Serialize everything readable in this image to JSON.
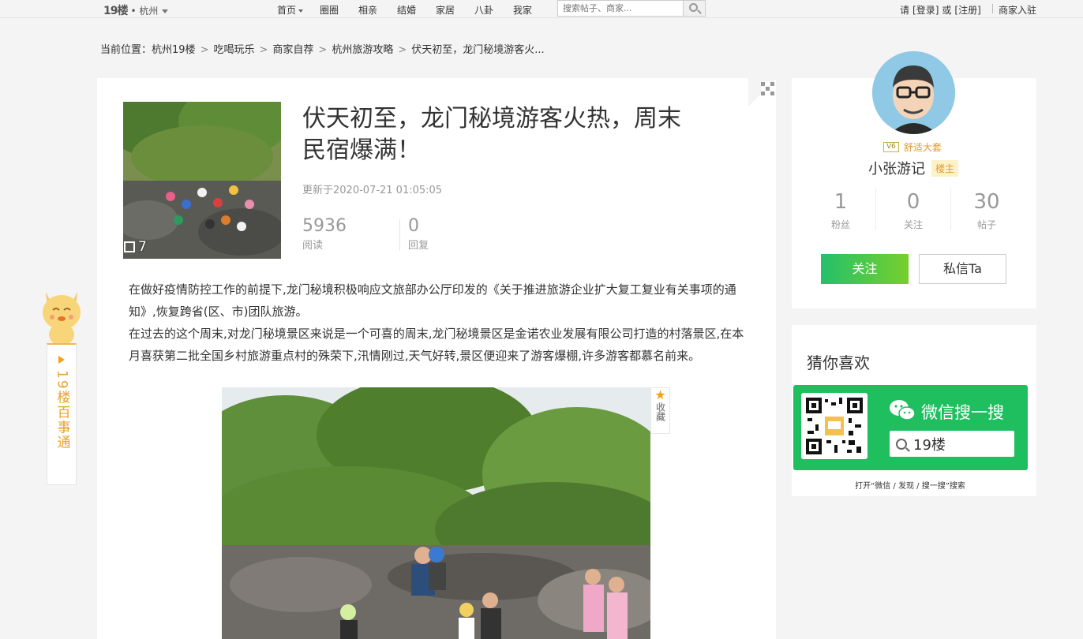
{
  "header": {
    "logo": "19楼",
    "city": "杭州",
    "nav": [
      "首页",
      "圈圈",
      "相亲",
      "结婚",
      "家居",
      "八卦",
      "我家"
    ],
    "search_placeholder": "搜索帖子、商家...",
    "login_prefix": "请",
    "login": "[登录]",
    "or": "或",
    "register": "[注册]",
    "merchant": "商家入驻"
  },
  "breadcrumb": {
    "prefix": "当前位置：",
    "items": [
      "杭州19楼",
      "吃喝玩乐",
      "商家自荐",
      "杭州旅游攻略",
      "伏天初至，龙门秘境游客火..."
    ],
    "separator": ">"
  },
  "post": {
    "title": "伏天初至，龙门秘境游客火热，周末民宿爆满！",
    "updated": "更新于2020-07-21 01:05:05",
    "photo_count": "7",
    "views": "5936",
    "views_label": "阅读",
    "replies": "0",
    "replies_label": "回复",
    "paragraphs": [
      "在做好疫情防控工作的前提下,龙门秘境积极响应文旅部办公厅印发的《关于推进旅游企业扩大复工复业有关事项的通知》,恢复跨省(区、市)团队旅游。",
      "在过去的这个周末,对龙门秘境景区来说是一个可喜的周末,龙门秘境景区是金诺农业发展有限公司打造的村落景区,在本月喜获第二批全国乡村旅游重点村的殊荣下,汛情刚过,天气好转,景区便迎来了游客爆棚,许多游客都慕名前来。"
    ],
    "favorite_label": "收藏"
  },
  "side_tab": {
    "label": "19楼百事通"
  },
  "profile": {
    "level_badge": "V6",
    "level_title": "舒适大套",
    "username": "小张游记",
    "owner_tag": "楼主",
    "stats": [
      {
        "value": "1",
        "label": "粉丝"
      },
      {
        "value": "0",
        "label": "关注"
      },
      {
        "value": "30",
        "label": "帖子"
      }
    ],
    "follow_label": "关注",
    "message_label": "私信Ta"
  },
  "recommend": {
    "title": "猜你喜欢",
    "wechat_title": "微信搜一搜",
    "wechat_query": "19楼",
    "hint": "打开“微信 / 发现 / 搜一搜”搜索"
  },
  "colors": {
    "accent_green": "#1fbf5f",
    "owner_tag_bg": "#fdf2c7",
    "level_color": "#e09a2a",
    "side_tab_text": "#e7a22b"
  }
}
